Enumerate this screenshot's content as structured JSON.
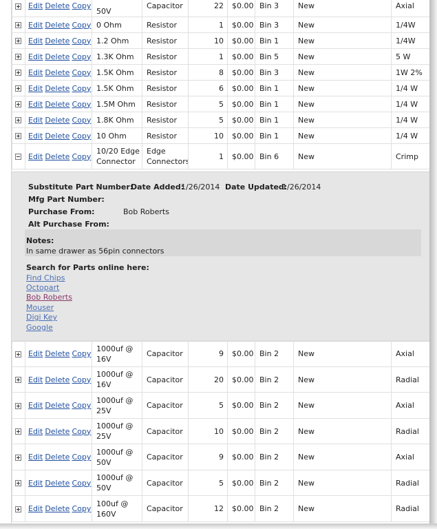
{
  "actions": {
    "edit": "Edit",
    "delete": "Delete",
    "copy": "Copy"
  },
  "rows_top": [
    {
      "value": "50V",
      "type": "Capacitor",
      "qty": "22",
      "price": "$0.00",
      "bin": "Bin 3",
      "condition": "New",
      "note": "Axial"
    },
    {
      "value": "0 Ohm",
      "type": "Resistor",
      "qty": "1",
      "price": "$0.00",
      "bin": "Bin 3",
      "condition": "New",
      "note": "1/4W"
    },
    {
      "value": "1.2 Ohm",
      "type": "Resistor",
      "qty": "10",
      "price": "$0.00",
      "bin": "Bin 1",
      "condition": "New",
      "note": "1/4W"
    },
    {
      "value": "1.3K Ohm",
      "type": "Resistor",
      "qty": "1",
      "price": "$0.00",
      "bin": "Bin 5",
      "condition": "New",
      "note": "5 W"
    },
    {
      "value": "1.5K Ohm",
      "type": "Resistor",
      "qty": "8",
      "price": "$0.00",
      "bin": "Bin 3",
      "condition": "New",
      "note": "1W 2%"
    },
    {
      "value": "1.5K Ohm",
      "type": "Resistor",
      "qty": "6",
      "price": "$0.00",
      "bin": "Bin 1",
      "condition": "New",
      "note": "1/4 W"
    },
    {
      "value": "1.5M Ohm",
      "type": "Resistor",
      "qty": "5",
      "price": "$0.00",
      "bin": "Bin 1",
      "condition": "New",
      "note": "1/4 W"
    },
    {
      "value": "1.8K Ohm",
      "type": "Resistor",
      "qty": "5",
      "price": "$0.00",
      "bin": "Bin 1",
      "condition": "New",
      "note": "1/4 W"
    },
    {
      "value": "10 Ohm",
      "type": "Resistor",
      "qty": "10",
      "price": "$0.00",
      "bin": "Bin 1",
      "condition": "New",
      "note": "1/4 W"
    },
    {
      "value": "10/20 Edge Connector",
      "type": "Edge Connectors",
      "qty": "1",
      "price": "$0.00",
      "bin": "Bin 6",
      "condition": "New",
      "note": "Crimp"
    }
  ],
  "detail": {
    "substitute_label": "Substitute Part Number:",
    "date_added_label": "Date Added:",
    "date_added": "1/26/2014",
    "date_updated_label": "Date Updated:",
    "date_updated": "1/26/2014",
    "mfg_label": "Mfg Part Number:",
    "purchase_from_label": "Purchase From:",
    "purchase_from": "Bob Roberts",
    "alt_purchase_label": "Alt Purchase From:",
    "notes_label": "Notes:",
    "notes_text": "In same drawer as 56pin connectors",
    "search_label": "Search for Parts online here:",
    "links": [
      "Find Chips",
      "Octopart",
      "Bob Roberts",
      "Mouser",
      "Digi Key",
      "Google"
    ]
  },
  "rows_bottom": [
    {
      "value": "1000uf @ 16V",
      "type": "Capacitor",
      "qty": "9",
      "price": "$0.00",
      "bin": "Bin 2",
      "condition": "New",
      "note": "Axial"
    },
    {
      "value": "1000uf @ 16V",
      "type": "Capacitor",
      "qty": "20",
      "price": "$0.00",
      "bin": "Bin 2",
      "condition": "New",
      "note": "Radial"
    },
    {
      "value": "1000uf @ 25V",
      "type": "Capacitor",
      "qty": "5",
      "price": "$0.00",
      "bin": "Bin 2",
      "condition": "New",
      "note": "Axial"
    },
    {
      "value": "1000uf @ 25V",
      "type": "Capacitor",
      "qty": "10",
      "price": "$0.00",
      "bin": "Bin 2",
      "condition": "New",
      "note": "Radial"
    },
    {
      "value": "1000uf @ 50V",
      "type": "Capacitor",
      "qty": "9",
      "price": "$0.00",
      "bin": "Bin 2",
      "condition": "New",
      "note": "Axial"
    },
    {
      "value": "1000uf @ 50V",
      "type": "Capacitor",
      "qty": "5",
      "price": "$0.00",
      "bin": "Bin 2",
      "condition": "New",
      "note": "Radial"
    },
    {
      "value": "100uf @ 160V",
      "type": "Capacitor",
      "qty": "12",
      "price": "$0.00",
      "bin": "Bin 2",
      "condition": "New",
      "note": "Radial"
    }
  ]
}
